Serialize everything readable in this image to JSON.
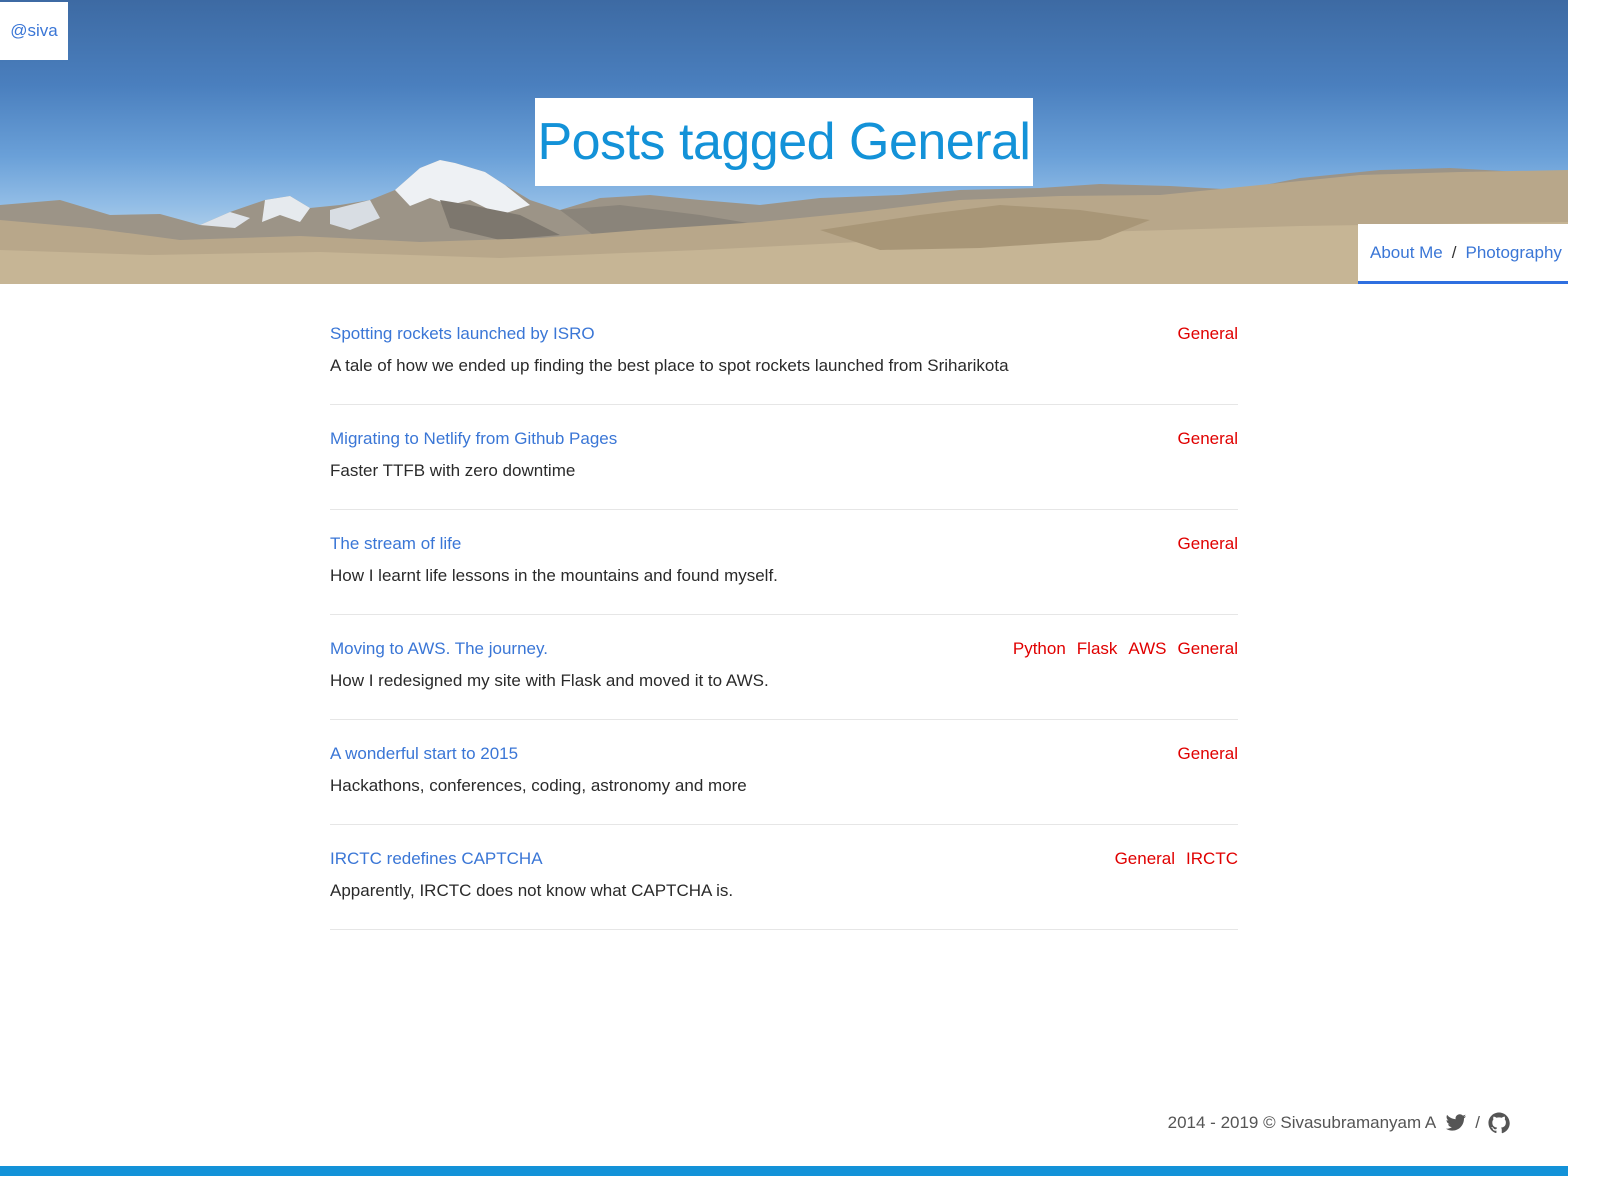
{
  "header": {
    "handle": "@siva",
    "page_title": "Posts tagged General",
    "nav": {
      "about": "About Me",
      "separator": "/",
      "photography": "Photography"
    }
  },
  "posts": [
    {
      "title": "Spotting rockets launched by ISRO",
      "description": "A tale of how we ended up finding the best place to spot rockets launched from Sriharikota",
      "tags": [
        "General"
      ]
    },
    {
      "title": "Migrating to Netlify from Github Pages",
      "description": "Faster TTFB with zero downtime",
      "tags": [
        "General"
      ]
    },
    {
      "title": "The stream of life",
      "description": "How I learnt life lessons in the mountains and found myself.",
      "tags": [
        "General"
      ]
    },
    {
      "title": "Moving to AWS. The journey.",
      "description": "How I redesigned my site with Flask and moved it to AWS.",
      "tags": [
        "Python",
        "Flask",
        "AWS",
        "General"
      ]
    },
    {
      "title": "A wonderful start to 2015",
      "description": "Hackathons, conferences, coding, astronomy and more",
      "tags": [
        "General"
      ]
    },
    {
      "title": "IRCTC redefines CAPTCHA",
      "description": "Apparently, IRCTC does not know what CAPTCHA is.",
      "tags": [
        "General",
        "IRCTC"
      ]
    }
  ],
  "footer": {
    "copyright": "2014 - 2019 © Sivasubramanyam A",
    "separator": "/",
    "icons": [
      "twitter-icon",
      "github-icon"
    ]
  },
  "colors": {
    "link": "#3a76d6",
    "tag": "#e00000",
    "title": "#1392d8",
    "accent_bar": "#1392d8",
    "nav_underline": "#2f6fe0"
  }
}
